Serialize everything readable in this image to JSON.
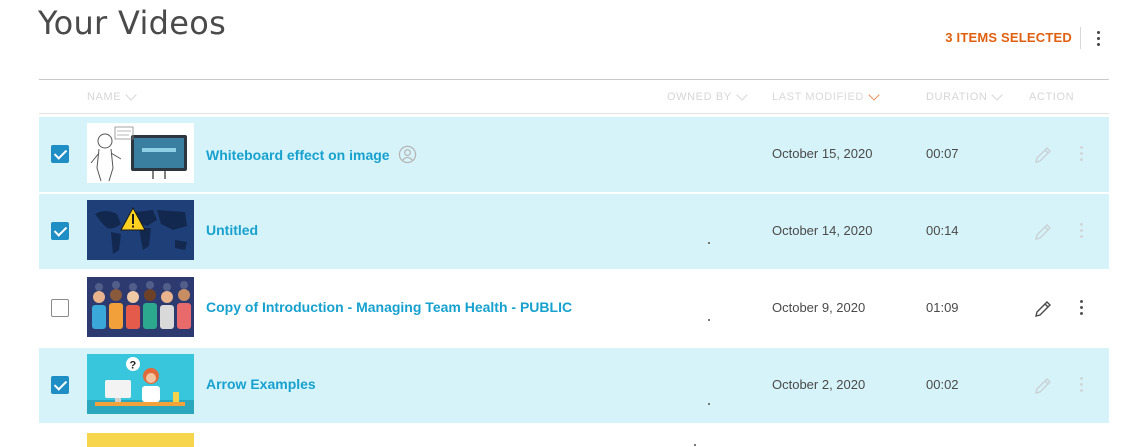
{
  "page": {
    "title": "Your Videos"
  },
  "selection": {
    "count_label": "3 ITEMS SELECTED"
  },
  "columns": {
    "name": "NAME",
    "owned_by": "OWNED BY",
    "last_modified": "LAST MODIFIED",
    "duration": "DURATION",
    "action": "ACTION"
  },
  "colors": {
    "accent": "#17a1cf",
    "selected_row": "#d6f3f9",
    "selection_label": "#e0600f",
    "checkbox": "#1f8ec4"
  },
  "rows": [
    {
      "title": "Whiteboard effect on image",
      "owner": "",
      "last_modified": "October 15, 2020",
      "duration": "00:07",
      "selected": true,
      "shared_icon": "shared-user-icon"
    },
    {
      "title": "Untitled",
      "owner": "",
      "last_modified": "October 14, 2020",
      "duration": "00:14",
      "selected": true
    },
    {
      "title": "Copy of Introduction - Managing Team Health - PUBLIC",
      "owner": "",
      "last_modified": "October 9, 2020",
      "duration": "01:09",
      "selected": false
    },
    {
      "title": "Arrow Examples",
      "owner": "",
      "last_modified": "October 2, 2020",
      "duration": "00:02",
      "selected": true
    }
  ]
}
